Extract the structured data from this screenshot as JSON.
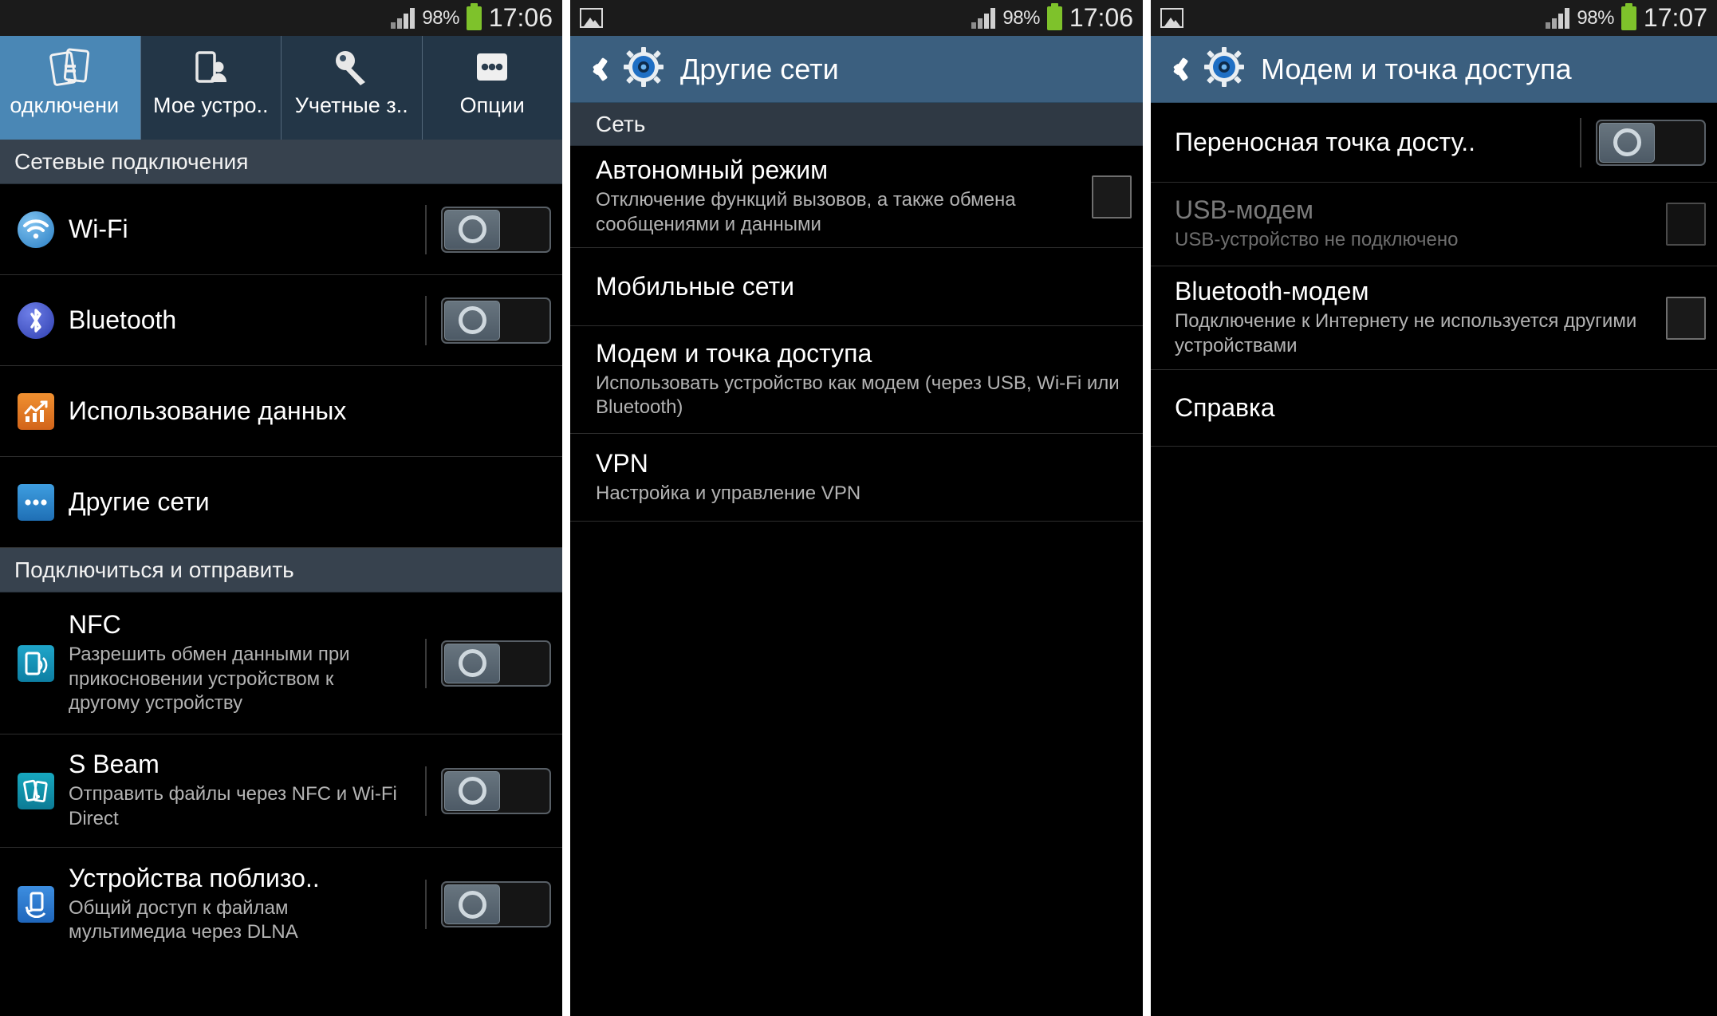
{
  "status_bar": {
    "signal_icon": "signal-bars-icon",
    "battery_percent": "98%",
    "battery_icon": "battery-icon",
    "time_left": "17:06",
    "time_middle": "17:06",
    "time_right": "17:07",
    "notification_icon": "picture-icon"
  },
  "panel1": {
    "tabs": [
      {
        "label": "одключени",
        "icon": "connections-icon",
        "active": true
      },
      {
        "label": "Мое устро..",
        "icon": "my-device-icon",
        "active": false
      },
      {
        "label": "Учетные з..",
        "icon": "accounts-key-icon",
        "active": false
      },
      {
        "label": "Опции",
        "icon": "more-options-icon",
        "active": false
      }
    ],
    "section_network": "Сетевые подключения",
    "section_share": "Подключиться и отправить",
    "rows": [
      {
        "title": "Wi-Fi",
        "sub": "",
        "icon": "wifi-icon",
        "control": "switch",
        "state": "off"
      },
      {
        "title": "Bluetooth",
        "sub": "",
        "icon": "bluetooth-icon",
        "control": "switch",
        "state": "off"
      },
      {
        "title": "Использование данных",
        "sub": "",
        "icon": "data-usage-icon",
        "control": "none",
        "state": ""
      },
      {
        "title": "Другие сети",
        "sub": "",
        "icon": "other-networks-icon",
        "control": "none",
        "state": ""
      }
    ],
    "share_rows": [
      {
        "title": "NFC",
        "sub": "Разрешить обмен данными при прикосновении устройством к другому устройству",
        "icon": "nfc-icon",
        "control": "switch",
        "state": "off"
      },
      {
        "title": "S Beam",
        "sub": "Отправить файлы через NFC и Wi-Fi Direct",
        "icon": "s-beam-icon",
        "control": "switch",
        "state": "off"
      },
      {
        "title": "Устройства поблизо..",
        "sub": "Общий доступ к файлам мультимедиа через DLNA",
        "icon": "nearby-devices-icon",
        "control": "switch",
        "state": "off"
      }
    ]
  },
  "panel2": {
    "title": "Другие сети",
    "back_icon": "back-chevron-icon",
    "gear_icon": "settings-gear-icon",
    "section": "Сеть",
    "rows": [
      {
        "title": "Автономный режим",
        "sub": "Отключение функций вызовов, а также обмена сообщениями и данными",
        "control": "checkbox",
        "state": "unchecked"
      },
      {
        "title": "Мобильные сети",
        "sub": "",
        "control": "none",
        "state": ""
      },
      {
        "title": "Модем и точка доступа",
        "sub": "Использовать устройство как модем (через USB, Wi-Fi или Bluetooth)",
        "control": "none",
        "state": ""
      },
      {
        "title": "VPN",
        "sub": "Настройка и управление VPN",
        "control": "none",
        "state": ""
      }
    ]
  },
  "panel3": {
    "title": "Модем и точка доступа",
    "back_icon": "back-chevron-icon",
    "gear_icon": "settings-gear-icon",
    "rows": [
      {
        "title": "Переносная точка досту..",
        "sub": "",
        "control": "switch",
        "state": "off",
        "disabled": false
      },
      {
        "title": "USB-модем",
        "sub": "USB-устройство не подключено",
        "control": "checkbox",
        "state": "unchecked",
        "disabled": true
      },
      {
        "title": "Bluetooth-модем",
        "sub": "Подключение к Интернету не используется другими устройствами",
        "control": "checkbox",
        "state": "unchecked",
        "disabled": false
      },
      {
        "title": "Справка",
        "sub": "",
        "control": "none",
        "state": "",
        "disabled": false
      }
    ]
  },
  "colors": {
    "accent_blue": "#4a87b5",
    "actionbar_blue": "#3b5f7f",
    "tabbar_dark": "#233647",
    "section_header": "#37424e",
    "battery_green": "#7ec22b"
  }
}
